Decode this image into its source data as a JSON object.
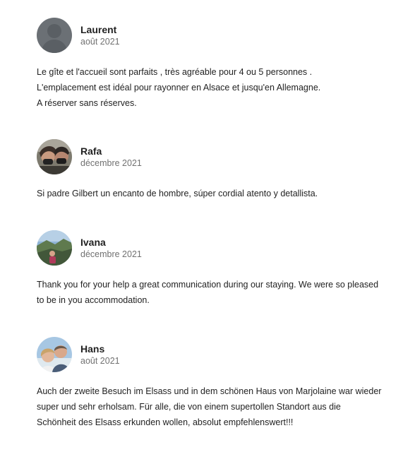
{
  "reviews": [
    {
      "name": "Laurent",
      "date": "août 2021",
      "avatar_icon": "default-user-avatar-icon",
      "lines": [
        "Le gîte et l'accueil sont parfaits , très agréable pour 4 ou 5 personnes .",
        "L'emplacement est idéal pour rayonner en Alsace et jusqu'en Allemagne.",
        "A réserver sans réserves."
      ]
    },
    {
      "name": "Rafa",
      "date": "décembre 2021",
      "avatar_icon": "user-photo-avatar",
      "lines": [
        "Si padre Gilbert un encanto de hombre, súper cordial atento y detallista."
      ]
    },
    {
      "name": "Ivana",
      "date": "décembre 2021",
      "avatar_icon": "user-photo-avatar",
      "lines": [
        "Thank you for your help a great communication during our staying. We were so pleased",
        "to be in you accommodation."
      ]
    },
    {
      "name": "Hans",
      "date": "août 2021",
      "avatar_icon": "user-photo-avatar",
      "lines": [
        "Auch der zweite Besuch im Elsass und in dem schönen Haus von Marjolaine war wieder",
        "super und sehr erholsam. Für alle, die von einem supertollen Standort aus die",
        "Schönheit des Elsass erkunden wollen, absolut empfehlenswert!!!"
      ]
    }
  ],
  "colors": {
    "text_primary": "#222222",
    "text_secondary": "#717171",
    "default_avatar_bg": "#6a6f73"
  }
}
